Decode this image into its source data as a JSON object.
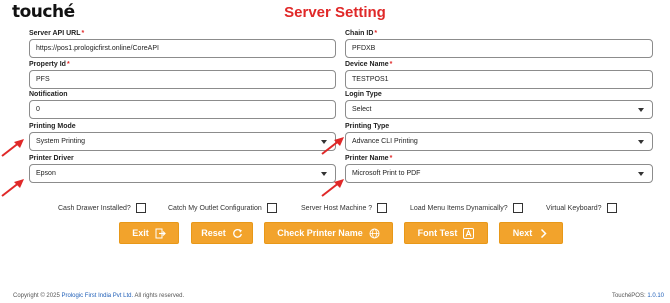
{
  "app": {
    "logo": "touché",
    "title": "Server Setting"
  },
  "fields": {
    "server_api_url": {
      "label": "Server API URL",
      "required": "*",
      "value": "https://pos1.prologicfirst.online/CoreAPI"
    },
    "chain_id": {
      "label": "Chain ID",
      "required": "*",
      "value": "PFDXB"
    },
    "property_id": {
      "label": "Property Id",
      "required": "*",
      "value": "PFS"
    },
    "device_name": {
      "label": "Device Name",
      "required": "*",
      "value": "TESTPOS1"
    },
    "notification": {
      "label": "Notification",
      "value": "0"
    },
    "login_type": {
      "label": "Login Type",
      "value": "Select"
    },
    "printing_mode": {
      "label": "Printing Mode",
      "value": "System Printing"
    },
    "printing_type": {
      "label": "Printing Type",
      "value": "Advance CLI Printing"
    },
    "printer_driver": {
      "label": "Printer Driver",
      "value": "Epson"
    },
    "printer_name": {
      "label": "Printer Name",
      "required": "*",
      "value": "Microsoft Print to PDF"
    }
  },
  "checkboxes": [
    {
      "label": "Cash Drawer Installed?",
      "checked": false
    },
    {
      "label": "Catch My Outlet Configuration",
      "checked": false
    },
    {
      "label": "Server Host Machine ?",
      "checked": false
    },
    {
      "label": "Load Menu Items Dynamically?",
      "checked": false
    },
    {
      "label": "Virtual Keyboard?",
      "checked": false
    }
  ],
  "buttons": {
    "exit": "Exit",
    "reset": "Reset",
    "check_printer": "Check Printer Name",
    "font_test": "Font Test",
    "next": "Next"
  },
  "footer": {
    "copyright_prefix": "Copyright © 2025",
    "company": "Prologic First India Pvt Ltd.",
    "rights": "All rights reserved.",
    "version_label": "TouchéPOS:",
    "version": "1.0.10"
  },
  "colors": {
    "accent": "#f2a32c",
    "title": "#e02828",
    "arrow": "#e02828",
    "link": "#1f5fb8"
  },
  "icons": {
    "exit": "exit-icon",
    "reset": "refresh-icon",
    "check_printer": "globe-icon",
    "font_test": "font-icon",
    "next": "chevron-right-icon",
    "annotation": "red-arrow-icon"
  }
}
